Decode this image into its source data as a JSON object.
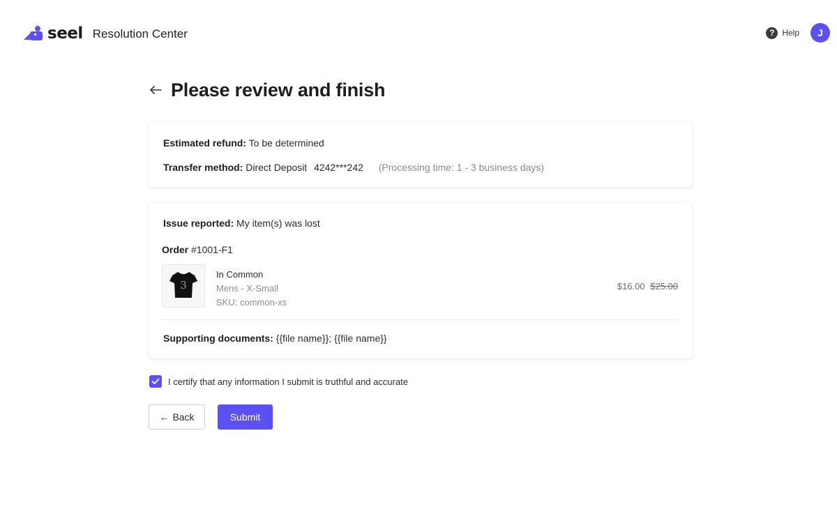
{
  "header": {
    "brand_name": "seel",
    "app_title": "Resolution Center",
    "help_label": "Help",
    "help_icon": "?",
    "avatar_initial": "J",
    "accent_color": "#5b50f2"
  },
  "page": {
    "title": "Please review and finish",
    "back_icon": "←"
  },
  "refund_card": {
    "estimated_refund_label": "Estimated refund:",
    "estimated_refund_value": "To be determined",
    "transfer_method_label": "Transfer method:",
    "transfer_method_value": "Direct Deposit",
    "account_number": "4242***242",
    "processing_time": "(Processing time: 1 - 3 business days)"
  },
  "issue_card": {
    "issue_label": "Issue reported:",
    "issue_value": "My item(s) was lost",
    "order_label": "Order",
    "order_number": "#1001-F1",
    "product": {
      "name": "In Common",
      "variant": "Mens - X-Small",
      "sku": "SKU: common-xs",
      "price": "$16.00",
      "original_price": "$25.00",
      "thumb_icon": "tshirt-icon"
    },
    "supporting_label": "Supporting documents:",
    "supporting_value": "{{file name}};  {{file name}}"
  },
  "certify": {
    "checked": true,
    "text": "I certify that any information I submit is truthful and accurate"
  },
  "actions": {
    "back_arrow": "←",
    "back_label": "Back",
    "submit_label": "Submit"
  }
}
